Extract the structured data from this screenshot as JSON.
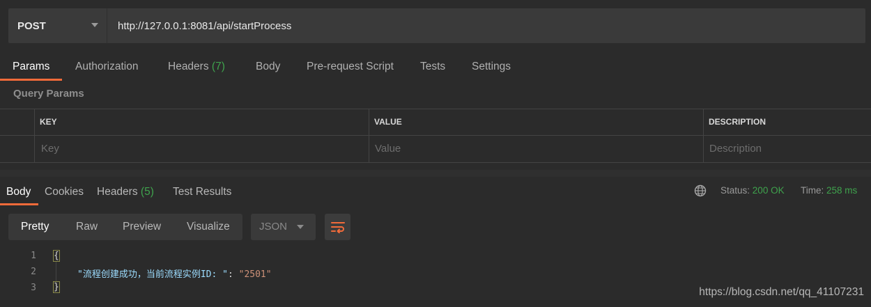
{
  "request": {
    "method": "POST",
    "url": "http://127.0.0.1:8081/api/startProcess"
  },
  "request_tabs": [
    {
      "label": "Params",
      "active": true
    },
    {
      "label": "Authorization"
    },
    {
      "label": "Headers",
      "count": "(7)"
    },
    {
      "label": "Body"
    },
    {
      "label": "Pre-request Script"
    },
    {
      "label": "Tests"
    },
    {
      "label": "Settings"
    }
  ],
  "query_params": {
    "title": "Query Params",
    "columns": [
      "KEY",
      "VALUE",
      "DESCRIPTION"
    ],
    "placeholders": [
      "Key",
      "Value",
      "Description"
    ]
  },
  "response_tabs": [
    {
      "label": "Body",
      "active": true
    },
    {
      "label": "Cookies"
    },
    {
      "label": "Headers",
      "count": "(5)"
    },
    {
      "label": "Test Results"
    }
  ],
  "status": {
    "status_label": "Status:",
    "status_value": "200 OK",
    "time_label": "Time:",
    "time_value": "258 ms"
  },
  "view_modes": [
    "Pretty",
    "Raw",
    "Preview",
    "Visualize"
  ],
  "format": "JSON",
  "code": {
    "line_numbers": [
      "1",
      "2",
      "3"
    ],
    "open_brace": "{",
    "key": "\"流程创建成功，当前流程实例ID: \"",
    "colon": ": ",
    "value": "\"2501\"",
    "close_brace": "}"
  },
  "watermark": "https://blog.csdn.net/qq_41107231",
  "colors": {
    "accent": "#f26b3a",
    "success": "#3fa34d",
    "background": "#2b2b2b"
  },
  "icons": {
    "globe": "globe-icon",
    "method_dropdown": "chevron-down-icon",
    "format_dropdown": "chevron-down-icon",
    "wrap": "wrap-lines-icon"
  }
}
